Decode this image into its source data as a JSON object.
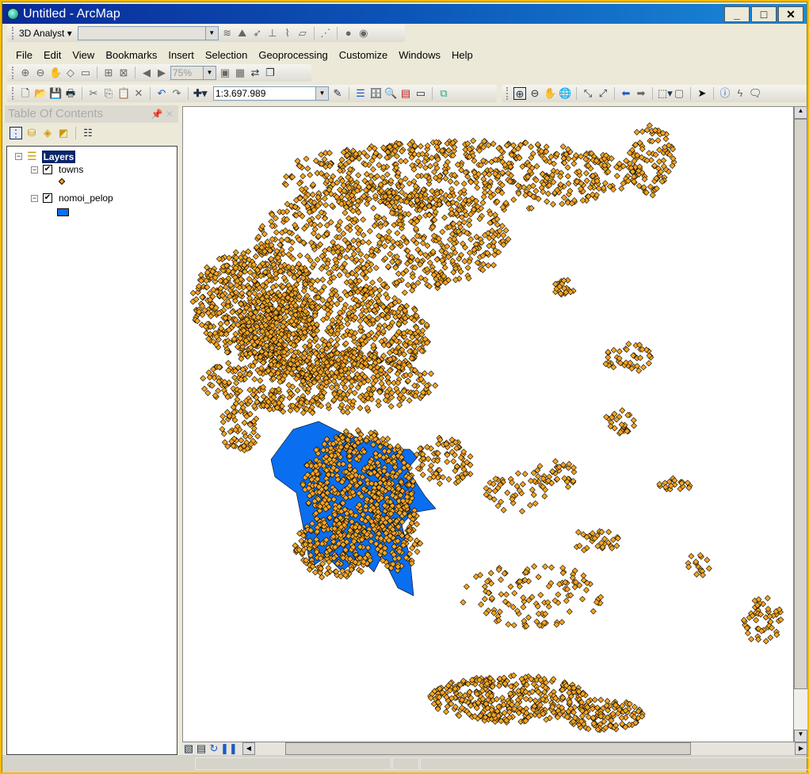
{
  "window": {
    "title": "Untitled - ArcMap",
    "minimize": "_",
    "maximize": "□",
    "close": "✕"
  },
  "toolbar_3d": {
    "label": "3D Analyst ▾",
    "layer_combo": ""
  },
  "menu": [
    "File",
    "Edit",
    "View",
    "Bookmarks",
    "Insert",
    "Selection",
    "Geoprocessing",
    "Customize",
    "Windows",
    "Help"
  ],
  "layout_toolbar": {
    "zoom_combo": "75%"
  },
  "standard_toolbar": {
    "scale": "1:3.697.989"
  },
  "toc": {
    "title": "Table Of Contents",
    "root": "Layers",
    "layers": [
      {
        "name": "towns",
        "checked": true,
        "symbol_color": "#f5a623"
      },
      {
        "name": "nomoi_pelop",
        "checked": true,
        "symbol_color": "#0a6ef0"
      }
    ]
  },
  "colors": {
    "point_fill": "#f5a623",
    "polygon_fill": "#0a6ef0",
    "title_start": "#0a2a98",
    "title_end": "#1a8ad8"
  }
}
